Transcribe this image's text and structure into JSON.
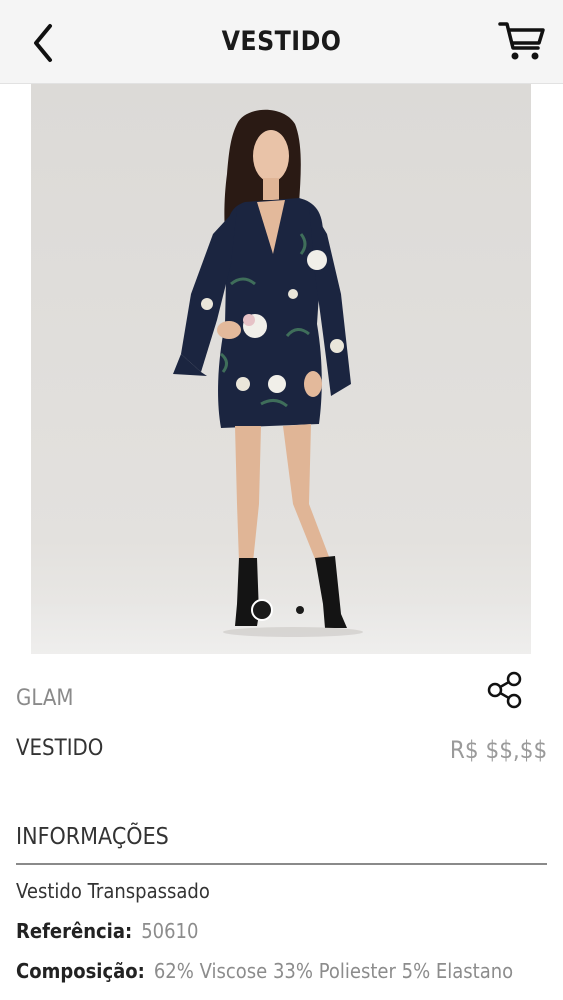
{
  "header": {
    "title": "VESTIDO",
    "back_icon": "chevron-left-icon",
    "cart_icon": "shopping-cart-icon"
  },
  "gallery": {
    "image_count": 2,
    "active_index": 0
  },
  "product": {
    "brand": "GLAM",
    "name": "VESTIDO",
    "price": "R$ $$,$$",
    "share_icon": "share-icon"
  },
  "info": {
    "section_title": "INFORMAÇÕES",
    "description": "Vestido Transpassado",
    "reference_label": "Referência:",
    "reference_value": "50610",
    "composition_label": "Composição:",
    "composition_value": "62% Viscose 33% Poliester 5% Elastano"
  },
  "colors": {
    "header_bg": "#f5f5f5",
    "backdrop": "#dcdad7",
    "dress": "#1b2540",
    "muted_text": "#8a8a8a"
  }
}
